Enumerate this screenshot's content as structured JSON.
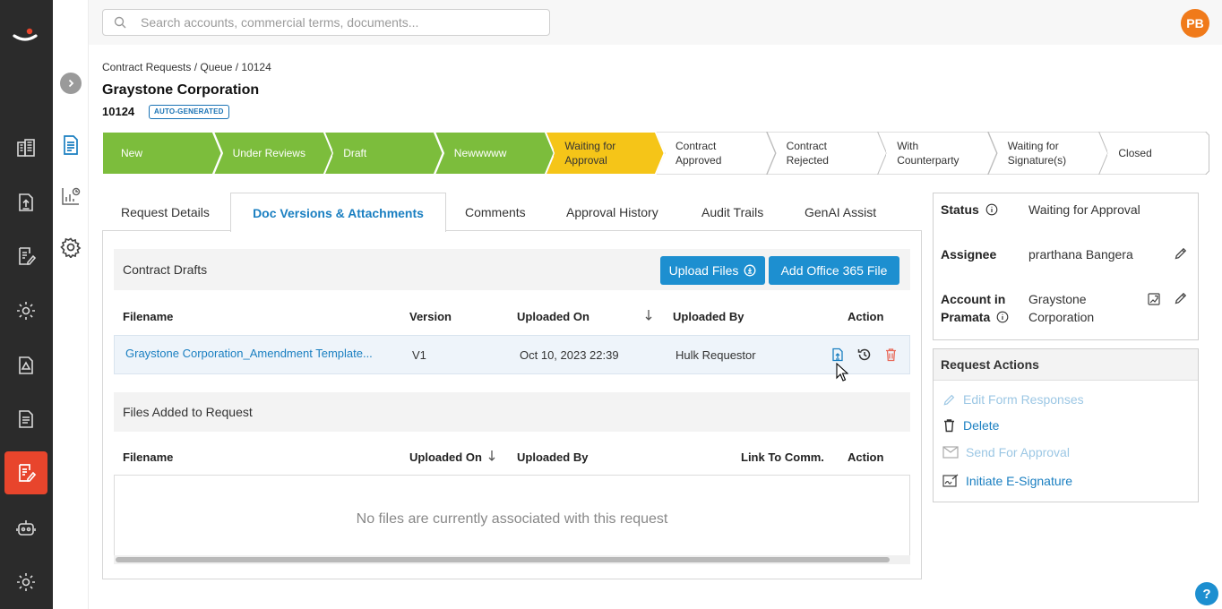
{
  "search": {
    "placeholder": "Search accounts, commercial terms, documents..."
  },
  "user": {
    "initials": "PB"
  },
  "breadcrumb": "Contract Requests / Queue / 10124",
  "title": "Graystone Corporation",
  "request_id": "10124",
  "id_badge": "AUTO-GENERATED",
  "stages": [
    {
      "label1": "New",
      "label2": "",
      "state": "done"
    },
    {
      "label1": "Under Reviews",
      "label2": "",
      "state": "done"
    },
    {
      "label1": "Draft",
      "label2": "",
      "state": "done"
    },
    {
      "label1": "Newwwww",
      "label2": "",
      "state": "done"
    },
    {
      "label1": "Waiting for",
      "label2": "Approval",
      "state": "current"
    },
    {
      "label1": "Contract",
      "label2": "Approved",
      "state": "pending"
    },
    {
      "label1": "Contract",
      "label2": "Rejected",
      "state": "pending"
    },
    {
      "label1": "With",
      "label2": "Counterparty",
      "state": "pending"
    },
    {
      "label1": "Waiting for",
      "label2": "Signature(s)",
      "state": "pending"
    },
    {
      "label1": "Closed",
      "label2": "",
      "state": "pending"
    }
  ],
  "colors": {
    "done": "#7cbd3c",
    "current": "#f5c518",
    "accent": "#1a7fc1",
    "brand": "#e8452c"
  },
  "tabs": [
    "Request Details",
    "Doc Versions & Attachments",
    "Comments",
    "Approval History",
    "Audit Trails",
    "GenAI Assist"
  ],
  "active_tab": "Doc Versions & Attachments",
  "drafts": {
    "title": "Contract Drafts",
    "upload_label": "Upload Files",
    "office_label": "Add Office 365 File",
    "columns": {
      "filename": "Filename",
      "version": "Version",
      "uploaded_on": "Uploaded On",
      "uploaded_by": "Uploaded By",
      "action": "Action"
    },
    "rows": [
      {
        "filename": "Graystone Corporation_Amendment Template...",
        "version": "V1",
        "uploaded_on": "Oct 10, 2023 22:39",
        "uploaded_by": "Hulk Requestor"
      }
    ]
  },
  "files": {
    "title": "Files Added to Request",
    "columns": {
      "filename": "Filename",
      "uploaded_on": "Uploaded On",
      "uploaded_by": "Uploaded By",
      "link": "Link To Comm.",
      "action": "Action"
    },
    "empty": "No files are currently associated with this request"
  },
  "info": {
    "status_label": "Status",
    "status_value": "Waiting for Approval",
    "assignee_label": "Assignee",
    "assignee_value": "prarthana Bangera",
    "account_label1": "Account in",
    "account_label2": "Pramata",
    "account_value1": "Graystone",
    "account_value2": "Corporation"
  },
  "actions": {
    "title": "Request Actions",
    "edit": "Edit Form Responses",
    "delete": "Delete",
    "send": "Send For Approval",
    "esign": "Initiate E-Signature"
  },
  "help": "?"
}
